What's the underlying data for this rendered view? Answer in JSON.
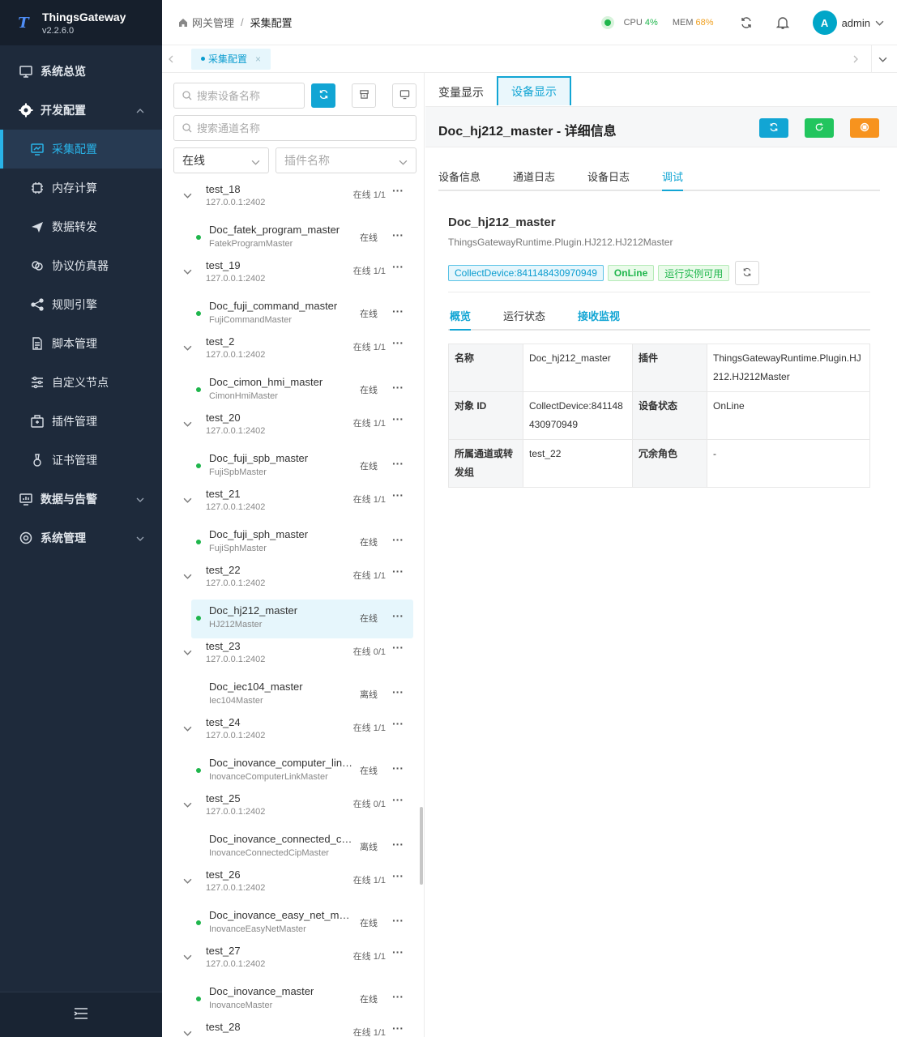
{
  "app": {
    "name": "ThingsGateway",
    "version": "v2.2.6.0"
  },
  "sidebar": {
    "items": [
      {
        "label": "系统总览",
        "icon": "monitor-icon",
        "level": "top"
      },
      {
        "label": "开发配置",
        "icon": "gear-icon",
        "level": "top",
        "expanded": true
      },
      {
        "label": "采集配置",
        "icon": "chart-board-icon",
        "level": "sub",
        "active": true
      },
      {
        "label": "内存计算",
        "icon": "chip-icon",
        "level": "sub"
      },
      {
        "label": "数据转发",
        "icon": "send-icon",
        "level": "sub"
      },
      {
        "label": "协议仿真器",
        "icon": "link-icon",
        "level": "sub"
      },
      {
        "label": "规则引擎",
        "icon": "share-icon",
        "level": "sub"
      },
      {
        "label": "脚本管理",
        "icon": "document-icon",
        "level": "sub"
      },
      {
        "label": "自定义节点",
        "icon": "sliders-icon",
        "level": "sub"
      },
      {
        "label": "插件管理",
        "icon": "package-icon",
        "level": "sub"
      },
      {
        "label": "证书管理",
        "icon": "certificate-icon",
        "level": "sub"
      },
      {
        "label": "数据与告警",
        "icon": "presentation-icon",
        "level": "top"
      },
      {
        "label": "系统管理",
        "icon": "settings-icon",
        "level": "top"
      }
    ]
  },
  "header": {
    "breadcrumb": [
      "网关管理",
      "采集配置"
    ],
    "cpu_label": "CPU",
    "cpu_value": "4%",
    "mem_label": "MEM",
    "mem_value": "68%",
    "avatar_letter": "A",
    "user": "admin"
  },
  "tabs": {
    "open_tab": "采集配置",
    "close_glyph": "×"
  },
  "device_panel": {
    "device_search_placeholder": "搜索设备名称",
    "channel_search_placeholder": "搜索通道名称",
    "status_select": "在线",
    "plugin_select_placeholder": "插件名称",
    "groups": [
      {
        "name": "test_18",
        "addr": "127.0.0.1:2402",
        "status": "在线 1/1",
        "device": {
          "name": "Doc_fatek_program_master",
          "plugin": "FatekProgramMaster",
          "status": "在线",
          "online": true
        }
      },
      {
        "name": "test_19",
        "addr": "127.0.0.1:2402",
        "status": "在线 1/1",
        "device": {
          "name": "Doc_fuji_command_master",
          "plugin": "FujiCommandMaster",
          "status": "在线",
          "online": true
        }
      },
      {
        "name": "test_2",
        "addr": "127.0.0.1:2402",
        "status": "在线 1/1",
        "device": {
          "name": "Doc_cimon_hmi_master",
          "plugin": "CimonHmiMaster",
          "status": "在线",
          "online": true
        }
      },
      {
        "name": "test_20",
        "addr": "127.0.0.1:2402",
        "status": "在线 1/1",
        "device": {
          "name": "Doc_fuji_spb_master",
          "plugin": "FujiSpbMaster",
          "status": "在线",
          "online": true
        }
      },
      {
        "name": "test_21",
        "addr": "127.0.0.1:2402",
        "status": "在线 1/1",
        "device": {
          "name": "Doc_fuji_sph_master",
          "plugin": "FujiSphMaster",
          "status": "在线",
          "online": true
        }
      },
      {
        "name": "test_22",
        "addr": "127.0.0.1:2402",
        "status": "在线 1/1",
        "device": {
          "name": "Doc_hj212_master",
          "plugin": "HJ212Master",
          "status": "在线",
          "online": true,
          "selected": true
        }
      },
      {
        "name": "test_23",
        "addr": "127.0.0.1:2402",
        "status": "在线 0/1",
        "device": {
          "name": "Doc_iec104_master",
          "plugin": "Iec104Master",
          "status": "离线",
          "online": false
        }
      },
      {
        "name": "test_24",
        "addr": "127.0.0.1:2402",
        "status": "在线 1/1",
        "device": {
          "name": "Doc_inovance_computer_link...",
          "plugin": "InovanceComputerLinkMaster",
          "status": "在线",
          "online": true
        }
      },
      {
        "name": "test_25",
        "addr": "127.0.0.1:2402",
        "status": "在线 0/1",
        "device": {
          "name": "Doc_inovance_connected_cip...",
          "plugin": "InovanceConnectedCipMaster",
          "status": "离线",
          "online": false
        }
      },
      {
        "name": "test_26",
        "addr": "127.0.0.1:2402",
        "status": "在线 1/1",
        "device": {
          "name": "Doc_inovance_easy_net_mast...",
          "plugin": "InovanceEasyNetMaster",
          "status": "在线",
          "online": true
        }
      },
      {
        "name": "test_27",
        "addr": "127.0.0.1:2402",
        "status": "在线 1/1",
        "device": {
          "name": "Doc_inovance_master",
          "plugin": "InovanceMaster",
          "status": "在线",
          "online": true
        }
      },
      {
        "name": "test_28",
        "addr": "",
        "status": "在线 1/1",
        "device": null
      }
    ]
  },
  "detail": {
    "view_tabs": [
      "变量显示",
      "设备显示"
    ],
    "active_view_tab": 1,
    "title": "Doc_hj212_master - 详细信息",
    "sub_tabs": [
      "设备信息",
      "通道日志",
      "设备日志",
      "调试"
    ],
    "active_sub_tab": 3,
    "device_name": "Doc_hj212_master",
    "plugin_full": "ThingsGatewayRuntime.Plugin.HJ212.HJ212Master",
    "tags": [
      "CollectDevice:841148430970949",
      "OnLine",
      "运行实例可用"
    ],
    "inner_tabs": [
      "概览",
      "运行状态",
      "接收监视"
    ],
    "active_inner_tab": 0,
    "info": {
      "name_label": "名称",
      "name_value": "Doc_hj212_master",
      "plugin_label": "插件",
      "plugin_value": "ThingsGatewayRuntime.Plugin.HJ212.HJ212Master",
      "id_label": "对象 ID",
      "id_value": "CollectDevice:841148430970949",
      "state_label": "设备状态",
      "state_value": "OnLine",
      "channel_label": "所属通道或转发组",
      "channel_value": "test_22",
      "redundant_label": "冗余角色",
      "redundant_value": "-"
    }
  },
  "colors": {
    "accent": "#12a5d4",
    "online": "#1fb64c",
    "warn": "#f0a020",
    "sidebar_bg": "#1e2a3b",
    "action_orange": "#f7931e",
    "action_green": "#22c55e"
  }
}
